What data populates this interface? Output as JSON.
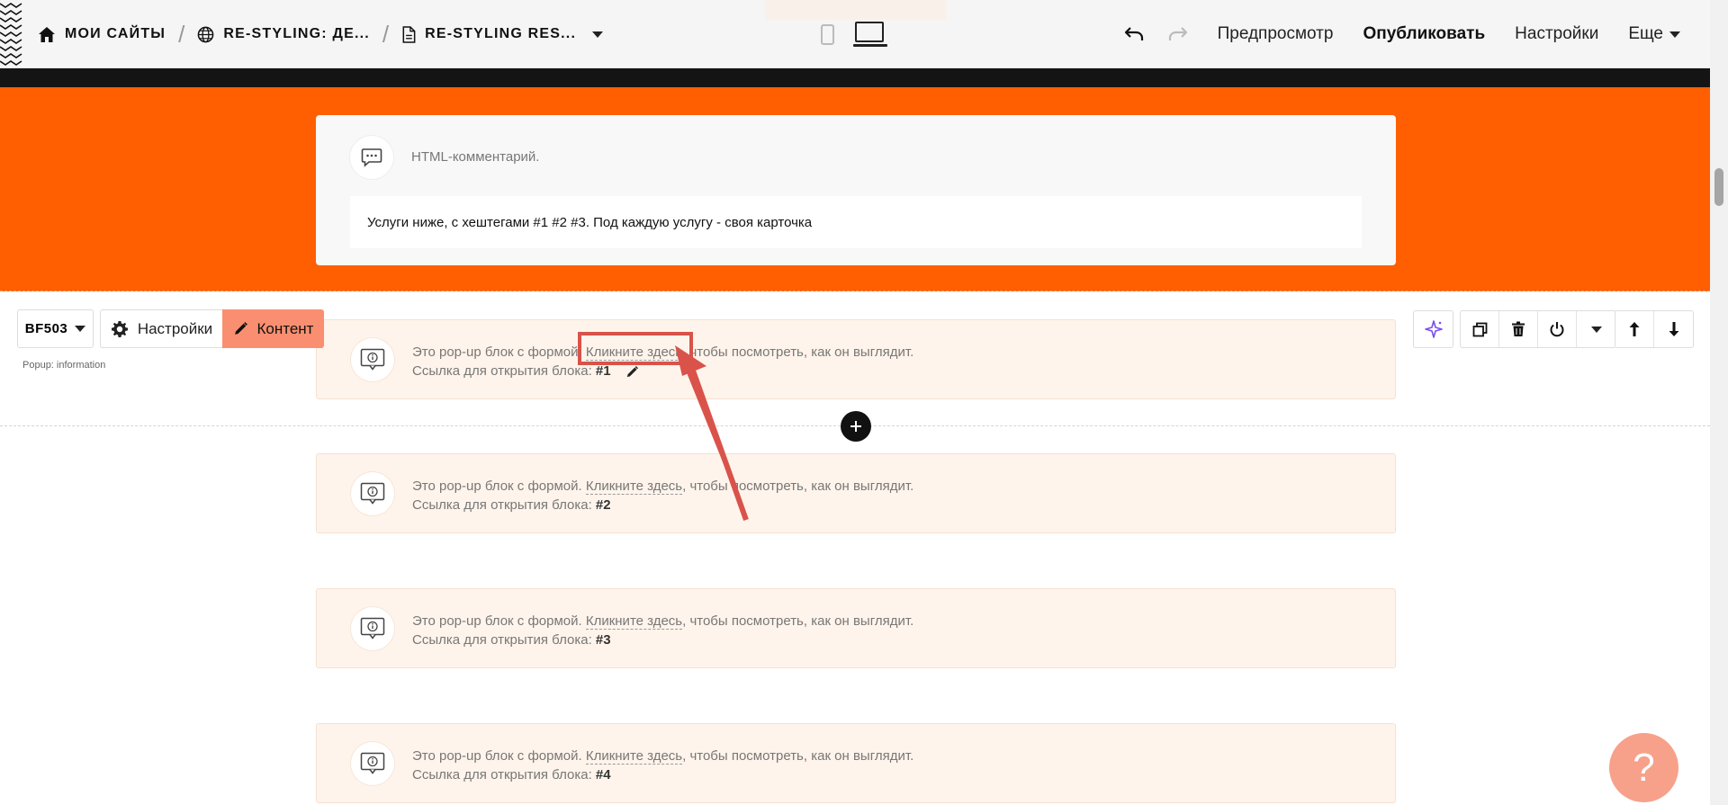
{
  "breadcrumbs": {
    "home": "МОИ САЙТЫ",
    "site": "RE-STYLING: ДЕ...",
    "page": "RE-STYLING RES..."
  },
  "topnav": {
    "preview": "Предпросмотр",
    "publish": "Опубликовать",
    "settings": "Настройки",
    "more": "Еще"
  },
  "comment_block": {
    "label": "HTML-комментарий.",
    "text": "Услуги ниже, с хештегами #1 #2 #3. Под каждую услугу - своя карточка"
  },
  "block_toolbar": {
    "block_id": "BF503",
    "settings_label": "Настройки",
    "content_label": "Контент",
    "caption": "Popup: information"
  },
  "popups": [
    {
      "text_before": "Это pop-up блок с формой. ",
      "link": "Кликните здесь",
      "text_after": ", чтобы посмотреть, как он выглядит.",
      "ref_label": "Ссылка для открытия блока: ",
      "hash": "#1"
    },
    {
      "text_before": "Это pop-up блок с формой. ",
      "link": "Кликните здесь",
      "text_after": ", чтобы посмотреть, как он выглядит.",
      "ref_label": "Ссылка для открытия блока: ",
      "hash": "#2"
    },
    {
      "text_before": "Это pop-up блок с формой. ",
      "link": "Кликните здесь",
      "text_after": ", чтобы посмотреть, как он выглядит.",
      "ref_label": "Ссылка для открытия блока: ",
      "hash": "#3"
    },
    {
      "text_before": "Это pop-up блок с формой. ",
      "link": "Кликните здесь",
      "text_after": ", чтобы посмотреть, как он выглядит.",
      "ref_label": "Ссылка для открытия блока: ",
      "hash": "#4"
    }
  ],
  "help": {
    "label": "?"
  },
  "colors": {
    "orange_section": "#ff5f00",
    "content_button": "#f98f70",
    "popup_card_bg": "#fff4eb",
    "annotation": "#d9534a",
    "help_button": "#f7a18a"
  },
  "icons": {
    "home": "home-icon",
    "site": "globe-icon",
    "page": "page-icon",
    "undo": "undo-icon",
    "redo": "redo-icon",
    "comment": "comment-dots-icon",
    "popup": "popup-info-icon",
    "settings": "gear-icon",
    "content": "pencil-icon",
    "ai": "sparkle-icon",
    "duplicate": "duplicate-icon",
    "delete": "trash-icon",
    "toggle": "power-icon",
    "move_up": "arrow-up-icon",
    "move_down": "arrow-down-icon",
    "add": "plus-icon"
  }
}
